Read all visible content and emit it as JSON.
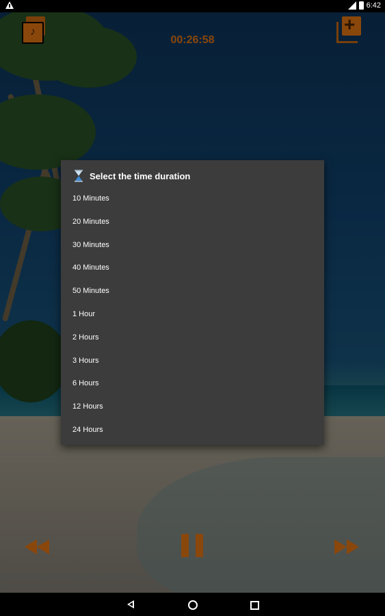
{
  "status_bar": {
    "time": "6:42",
    "icons": [
      "warning-icon",
      "signal-icon",
      "battery-icon"
    ]
  },
  "header": {
    "timer": "00:26:58",
    "left_icon": "music-library-icon",
    "right_icon": "add-playlist-icon"
  },
  "dialog": {
    "title": "Select the time duration",
    "title_icon": "hourglass-icon",
    "options": [
      "10 Minutes",
      "20 Minutes",
      "30 Minutes",
      "40 Minutes",
      "50 Minutes",
      "1 Hour",
      "2 Hours",
      "3 Hours",
      "6 Hours",
      "12 Hours",
      "24 Hours"
    ]
  },
  "controls": {
    "rewind_icon": "rewind-icon",
    "pause_icon": "pause-icon",
    "forward_icon": "fast-forward-icon"
  },
  "nav_bar": {
    "back": "back-icon",
    "home": "home-icon",
    "recents": "recents-icon"
  },
  "colors": {
    "accent": "#8a470c",
    "dialog_bg": "#3c3c3c"
  }
}
